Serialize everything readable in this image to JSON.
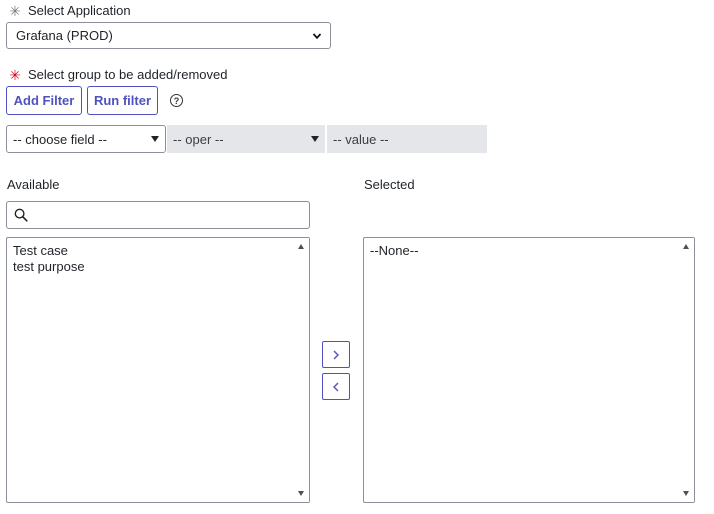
{
  "application": {
    "label": "Select Application",
    "value": "Grafana (PROD)"
  },
  "group": {
    "label": "Select group to be added/removed"
  },
  "filter": {
    "add_label": "Add Filter",
    "run_label": "Run filter",
    "help_glyph": "?",
    "field_placeholder": "-- choose field --",
    "oper_placeholder": "-- oper --",
    "value_placeholder": "-- value --"
  },
  "available": {
    "heading": "Available",
    "search_placeholder": "",
    "items": [
      "Test case",
      "test purpose"
    ]
  },
  "selected": {
    "heading": "Selected",
    "items": [
      "--None--"
    ]
  },
  "colors": {
    "accent": "#4f52bd",
    "required": "#d0021b",
    "disabled_bg": "#e4e6ea"
  }
}
